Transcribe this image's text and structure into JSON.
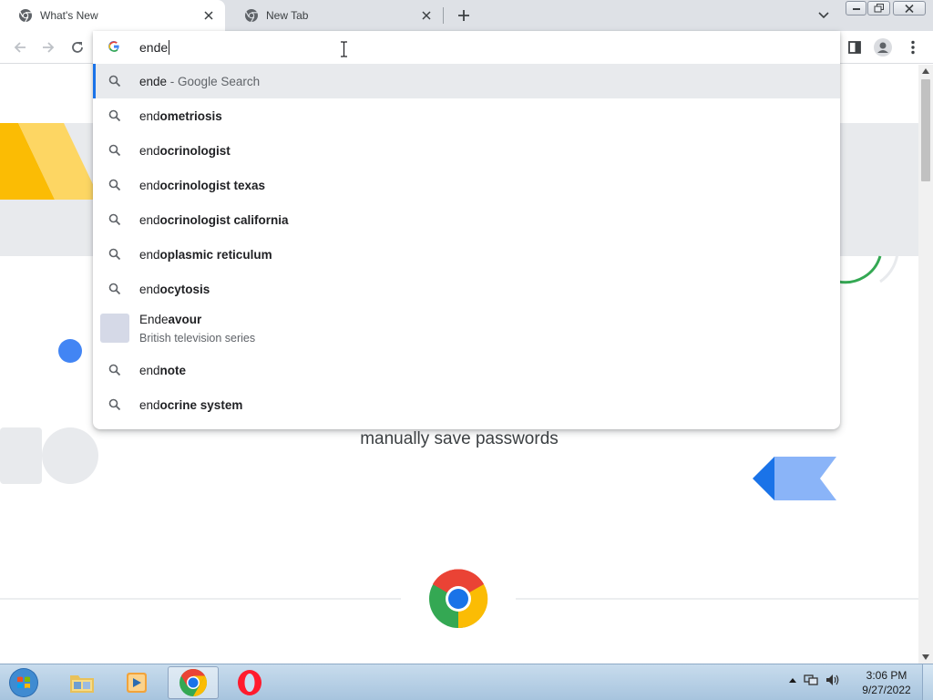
{
  "tabs": [
    {
      "title": "What's New",
      "active": true,
      "icon": "chrome-icon"
    },
    {
      "title": "New Tab",
      "active": false,
      "icon": "chrome-icon"
    }
  ],
  "omnibox": {
    "value": "ende",
    "suggestions": [
      {
        "prefix": "ende",
        "completion": "",
        "hint": " - Google Search",
        "type": "search"
      },
      {
        "prefix": "end",
        "completion": "ometriosis",
        "type": "search"
      },
      {
        "prefix": "end",
        "completion": "ocrinologist",
        "type": "search"
      },
      {
        "prefix": "end",
        "completion": "ocrinologist texas",
        "type": "search"
      },
      {
        "prefix": "end",
        "completion": "ocrinologist california",
        "type": "search"
      },
      {
        "prefix": "end",
        "completion": "oplasmic reticulum",
        "type": "search"
      },
      {
        "prefix": "end",
        "completion": "ocytosis",
        "type": "search"
      },
      {
        "prefix": "Ende",
        "completion": "avour",
        "subtitle": "British television series",
        "type": "entity"
      },
      {
        "prefix": "end",
        "completion": "note",
        "type": "search"
      },
      {
        "prefix": "end",
        "completion": "ocrine system",
        "type": "search"
      }
    ]
  },
  "page": {
    "headline": "manually save passwords"
  },
  "taskbar": {
    "time": "3:06 PM",
    "date": "9/27/2022"
  },
  "colors": {
    "accent": "#1a73e8",
    "tabstrip": "#dee1e6",
    "yellow": "#fbbc04",
    "green": "#34a853",
    "blue": "#4285f4"
  }
}
